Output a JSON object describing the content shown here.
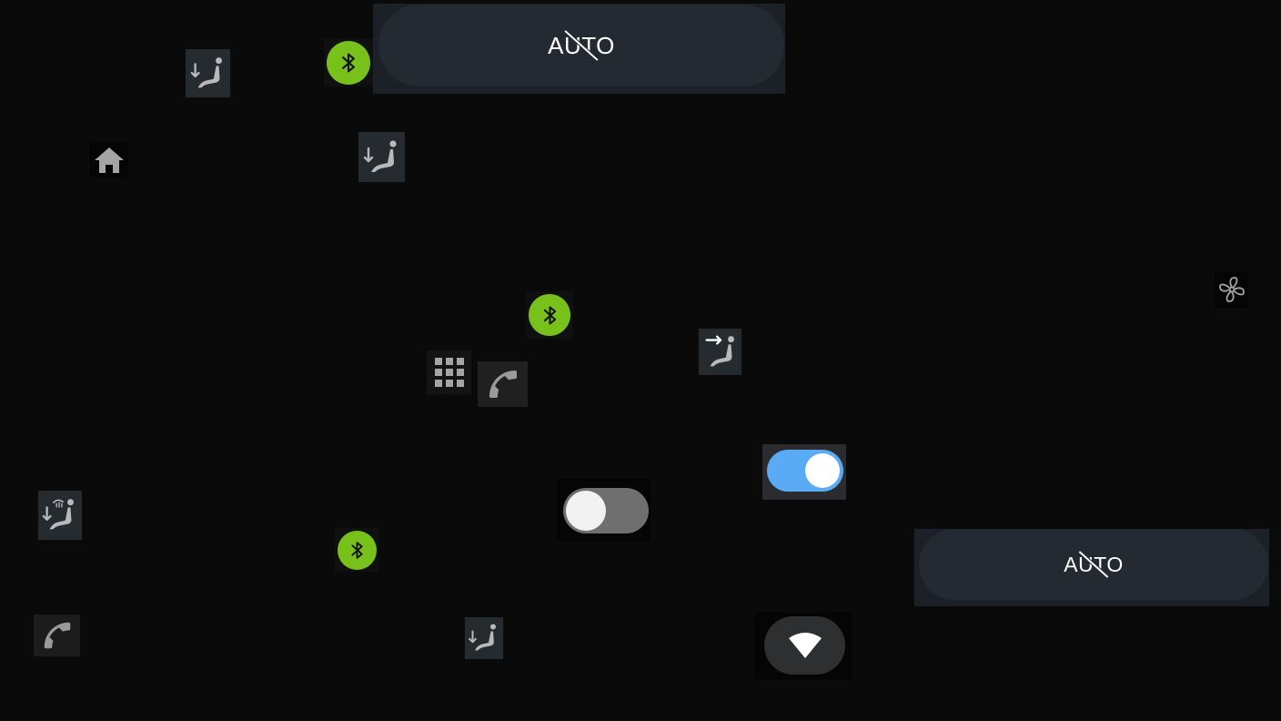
{
  "climate": {
    "auto_top": {
      "label": "AUTO",
      "state": "off"
    },
    "auto_bottom": {
      "label": "AUTO",
      "state": "off"
    },
    "fan": {
      "icon": "fan-icon"
    }
  },
  "toggles": {
    "toggle_left": {
      "state": "off"
    },
    "toggle_right": {
      "state": "on"
    }
  },
  "icons": {
    "home": "home-icon",
    "bluetooth": "bluetooth-icon",
    "phone": "phone-icon",
    "apps": "grid-icon",
    "seat_down": "seat-down-arrow-icon",
    "seat_right": "seat-right-arrow-icon",
    "seat_heat": "seat-heat-icon",
    "wifi": "wifi-icon"
  },
  "colors": {
    "background": "#0a0a0a",
    "bluetooth_green": "#77c11a",
    "toggle_on_blue": "#5aaaf5",
    "auto_panel": "#1b2126"
  }
}
